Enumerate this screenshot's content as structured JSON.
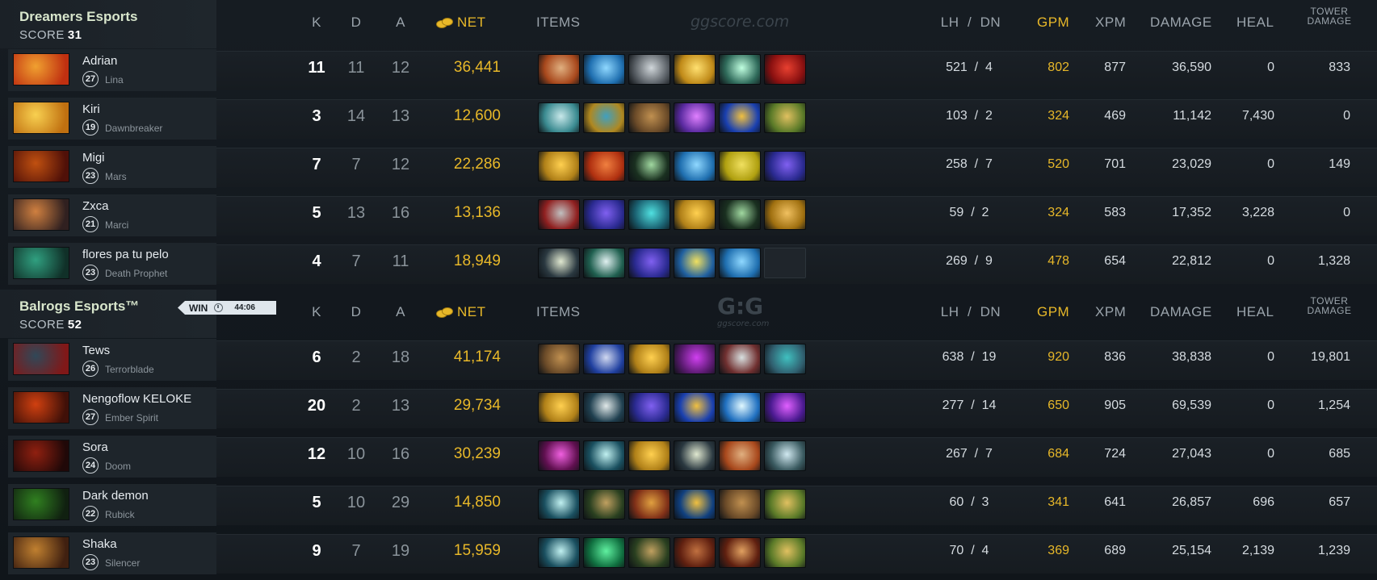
{
  "columns": {
    "k": "K",
    "d": "D",
    "a": "A",
    "net": "NET",
    "items": "ITEMS",
    "lh_dn": "LH  /  DN",
    "gpm": "GPM",
    "xpm": "XPM",
    "damage": "DAMAGE",
    "heal": "HEAL",
    "tower_damage_1": "TOWER",
    "tower_damage_2": "DAMAGE"
  },
  "watermark_1": "ggscore.com",
  "watermark_logo": "G:G",
  "watermark_2": "ggscore.com",
  "result": {
    "label": "WIN",
    "time": "44:06"
  },
  "colors": {
    "gold": "#e8b829",
    "kills": "#ffffff",
    "muted": "#8a939a",
    "team_name": "#d8e6cc"
  },
  "teams": [
    {
      "name": "Dreamers Esports",
      "score_label": "SCORE",
      "score": "31",
      "players": [
        {
          "name": "Adrian",
          "level": "27",
          "hero": "Lina",
          "k": "11",
          "d": "11",
          "a": "12",
          "net": "36,441",
          "lh": "521",
          "dn": "4",
          "gpm": "802",
          "xpm": "877",
          "damage": "36,590",
          "heal": "0",
          "tower": "833",
          "portrait": [
            "#f0a030",
            "#c03010"
          ],
          "items": [
            [
              "#a8481c",
              "#e0b080"
            ],
            [
              "#1f6fb0",
              "#8fd8ff"
            ],
            [
              "#5a6066",
              "#d0d6da"
            ],
            [
              "#c08a18",
              "#ffe070"
            ],
            [
              "#2f6a5a",
              "#c0ffe0"
            ],
            [
              "#8a1010",
              "#e84030"
            ]
          ]
        },
        {
          "name": "Kiri",
          "level": "19",
          "hero": "Dawnbreaker",
          "k": "3",
          "d": "14",
          "a": "13",
          "net": "12,600",
          "lh": "103",
          "dn": "2",
          "gpm": "324",
          "xpm": "469",
          "damage": "11,142",
          "heal": "7,430",
          "tower": "0",
          "portrait": [
            "#f8d050",
            "#c07010"
          ],
          "items": [
            [
              "#3a8a90",
              "#c8e8ea"
            ],
            [
              "#b08820",
              "#40a0c0"
            ],
            [
              "#6a4a28",
              "#c09050"
            ],
            [
              "#5a2aa0",
              "#e080ff"
            ],
            [
              "#1a40b0",
              "#f0c040"
            ],
            [
              "#5a7a28",
              "#e0c060"
            ]
          ]
        },
        {
          "name": "Migi",
          "level": "23",
          "hero": "Mars",
          "k": "7",
          "d": "7",
          "a": "12",
          "net": "22,286",
          "lh": "258",
          "dn": "7",
          "gpm": "520",
          "xpm": "701",
          "damage": "23,029",
          "heal": "0",
          "tower": "149",
          "portrait": [
            "#c05010",
            "#501008"
          ],
          "items": [
            [
              "#b08018",
              "#ffd050"
            ],
            [
              "#b03010",
              "#f08040"
            ],
            [
              "#1a3020",
              "#a0d8a0"
            ],
            [
              "#1f6fb0",
              "#8fd8ff"
            ],
            [
              "#b0a010",
              "#f0e060"
            ],
            [
              "#2a2a90",
              "#8060f0"
            ]
          ]
        },
        {
          "name": "Zxca",
          "level": "21",
          "hero": "Marci",
          "k": "5",
          "d": "13",
          "a": "16",
          "net": "13,136",
          "lh": "59",
          "dn": "2",
          "gpm": "324",
          "xpm": "583",
          "damage": "17,352",
          "heal": "3,228",
          "tower": "0",
          "portrait": [
            "#d08040",
            "#302020"
          ],
          "items": [
            [
              "#902020",
              "#c0c0c0"
            ],
            [
              "#2a2a90",
              "#8060f0"
            ],
            [
              "#1a6070",
              "#50e0e0"
            ],
            [
              "#b08018",
              "#ffd050"
            ],
            [
              "#1a3020",
              "#a0d8a0"
            ],
            [
              "#a07010",
              "#f0c060"
            ]
          ]
        },
        {
          "name": "flores pa tu pelo",
          "level": "23",
          "hero": "Death Prophet",
          "k": "4",
          "d": "7",
          "a": "11",
          "net": "18,949",
          "lh": "269",
          "dn": "9",
          "gpm": "478",
          "xpm": "654",
          "damage": "22,812",
          "heal": "0",
          "tower": "1,328",
          "portrait": [
            "#30a080",
            "#103028"
          ],
          "items": [
            [
              "#2a3840",
              "#e0e8d0"
            ],
            [
              "#206050",
              "#e0f0f0"
            ],
            [
              "#2a2a90",
              "#8060f0"
            ],
            [
              "#2060a0",
              "#f0e060"
            ],
            [
              "#1f6fb0",
              "#8fd8ff"
            ],
            null
          ]
        }
      ]
    },
    {
      "name": "Balrogs  Esports™",
      "score_label": "SCORE",
      "score": "52",
      "players": [
        {
          "name": "Tews",
          "level": "26",
          "hero": "Terrorblade",
          "k": "6",
          "d": "2",
          "a": "18",
          "net": "41,174",
          "lh": "638",
          "dn": "19",
          "gpm": "920",
          "xpm": "836",
          "damage": "38,838",
          "heal": "0",
          "tower": "19,801",
          "portrait": [
            "#304858",
            "#801818"
          ],
          "items": [
            [
              "#6a4a28",
              "#c09050"
            ],
            [
              "#2040a0",
              "#d0d8f0"
            ],
            [
              "#b08018",
              "#ffd050"
            ],
            [
              "#5a1a70",
              "#d040f0"
            ],
            [
              "#703030",
              "#d8e0e0"
            ],
            [
              "#306070",
              "#40c0c0"
            ]
          ]
        },
        {
          "name": "Nengoflow KELOKE",
          "level": "27",
          "hero": "Ember Spirit",
          "k": "20",
          "d": "2",
          "a": "13",
          "net": "29,734",
          "lh": "277",
          "dn": "14",
          "gpm": "650",
          "xpm": "905",
          "damage": "69,539",
          "heal": "0",
          "tower": "1,254",
          "portrait": [
            "#d04010",
            "#401008"
          ],
          "items": [
            [
              "#b08018",
              "#ffd050"
            ],
            [
              "#204050",
              "#e0e8e8"
            ],
            [
              "#2a2a90",
              "#8060f0"
            ],
            [
              "#1a40b0",
              "#f0c040"
            ],
            [
              "#2070c0",
              "#e0f8ff"
            ],
            [
              "#4a1a90",
              "#e060ff"
            ]
          ]
        },
        {
          "name": "Sora",
          "level": "24",
          "hero": "Doom",
          "k": "12",
          "d": "10",
          "a": "16",
          "net": "30,239",
          "lh": "267",
          "dn": "7",
          "gpm": "684",
          "xpm": "724",
          "damage": "27,043",
          "heal": "0",
          "tower": "685",
          "portrait": [
            "#902010",
            "#200808"
          ],
          "items": [
            [
              "#601050",
              "#f060e0"
            ],
            [
              "#1a5060",
              "#c0f0f0"
            ],
            [
              "#b08018",
              "#ffd050"
            ],
            [
              "#2a3840",
              "#e0e8d0"
            ],
            [
              "#a8481c",
              "#e0b080"
            ],
            [
              "#3a5a60",
              "#d0e8f0"
            ]
          ]
        },
        {
          "name": "Dark demon",
          "level": "22",
          "hero": "Rubick",
          "k": "5",
          "d": "10",
          "a": "29",
          "net": "14,850",
          "lh": "60",
          "dn": "3",
          "gpm": "341",
          "xpm": "641",
          "damage": "26,857",
          "heal": "696",
          "tower": "657",
          "portrait": [
            "#308020",
            "#102010"
          ],
          "items": [
            [
              "#1a5060",
              "#c0f0f0"
            ],
            [
              "#2a4020",
              "#c0a060"
            ],
            [
              "#803018",
              "#e0a040"
            ],
            [
              "#104080",
              "#f0c040"
            ],
            [
              "#6a4a28",
              "#c09050"
            ],
            [
              "#5a7a28",
              "#e0c060"
            ]
          ]
        },
        {
          "name": "Shaka",
          "level": "23",
          "hero": "Silencer",
          "k": "9",
          "d": "7",
          "a": "19",
          "net": "15,959",
          "lh": "70",
          "dn": "4",
          "gpm": "369",
          "xpm": "689",
          "damage": "25,154",
          "heal": "2,139",
          "tower": "1,239",
          "portrait": [
            "#c08030",
            "#402010"
          ],
          "items": [
            [
              "#1a5060",
              "#c0f0f0"
            ],
            [
              "#107040",
              "#60f0a0"
            ],
            [
              "#2a4020",
              "#c0a060"
            ],
            [
              "#602010",
              "#c07040"
            ],
            [
              "#602010",
              "#e0a060"
            ],
            [
              "#5a7a28",
              "#e0c060"
            ]
          ]
        }
      ]
    }
  ]
}
